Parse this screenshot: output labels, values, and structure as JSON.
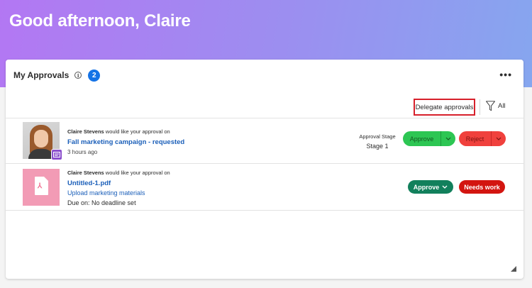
{
  "greeting": "Good afternoon, Claire",
  "card": {
    "title": "My Approvals",
    "info_icon": "i",
    "count": "2",
    "more_icon": "•••"
  },
  "toolbar": {
    "delegate_label": "Delegate approvals",
    "filter_label": "All"
  },
  "approvals": [
    {
      "requester": "Claire Stevens",
      "request_text": "would like your approval on",
      "title": "Fall marketing campaign - requested",
      "time": "3 hours ago",
      "stage_label": "Approval Stage",
      "stage_value": "Stage 1",
      "approve_label": "Approve",
      "reject_label": "Reject",
      "thumbnail": "avatar-photo"
    },
    {
      "requester": "Claire Stevens",
      "request_text": "would like your approval on",
      "file_name": "Untitled-1.pdf",
      "task": "Upload marketing materials",
      "due": "Due on: No deadline set",
      "approve_label": "Approve",
      "needs_work_label": "Needs work",
      "thumbnail": "pdf-file"
    }
  ],
  "colors": {
    "accent_blue": "#1473e6",
    "approve_green": "#2dc653",
    "reject_red": "#f0413d",
    "approve_dark_green": "#12805c",
    "needs_work_red": "#d31510",
    "delegate_outline": "#d7202b"
  }
}
